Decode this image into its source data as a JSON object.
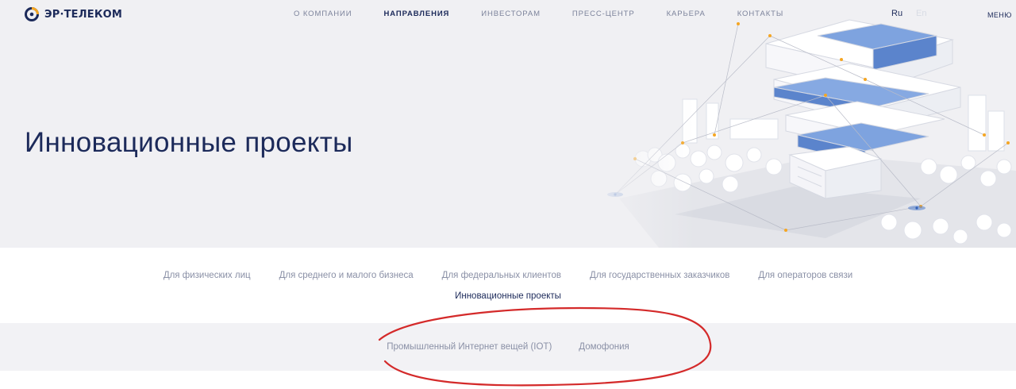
{
  "brand": {
    "logo_text": "ЭР·ТЕЛЕКОМ",
    "accent": "#1c2a5a",
    "logo_orange": "#f5a623"
  },
  "nav": {
    "items": [
      {
        "label": "О компании",
        "active": false
      },
      {
        "label": "Направления",
        "active": true
      },
      {
        "label": "Инвесторам",
        "active": false
      },
      {
        "label": "Пресс-центр",
        "active": false
      },
      {
        "label": "Карьера",
        "active": false
      },
      {
        "label": "Контакты",
        "active": false
      }
    ]
  },
  "lang": {
    "ru": "Ru",
    "en": "En"
  },
  "menu": {
    "label": "Меню"
  },
  "hero": {
    "title": "Инновационные проекты"
  },
  "categories": {
    "row1": [
      "Для физических лиц",
      "Для среднего и малого бизнеса",
      "Для федеральных клиентов",
      "Для государственных заказчиков",
      "Для операторов связи"
    ],
    "active": "Инновационные проекты"
  },
  "subnav": {
    "items": [
      "Промышленный Интернет вещей (IOT)",
      "Домофония"
    ]
  },
  "annotation": {
    "color": "#d42a2a"
  }
}
